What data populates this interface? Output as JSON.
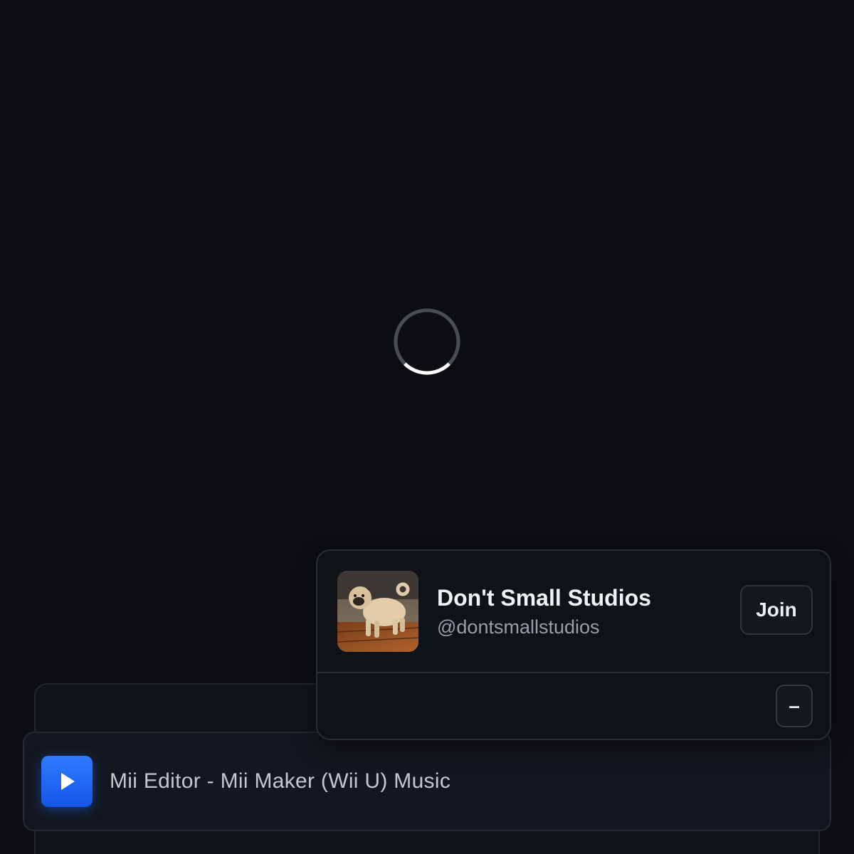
{
  "loading": {
    "indicator": "loading-spinner-icon"
  },
  "studio": {
    "name": "Don't Small Studios",
    "handle": "@dontsmallstudios",
    "join_label": "Join",
    "minimize_label": "–",
    "avatar_description_icon": "pug-avatar-image"
  },
  "player": {
    "play_icon": "play-icon",
    "track_title": "Mii Editor - Mii Maker (Wii U) Music"
  },
  "colors": {
    "background": "#0c0e13",
    "accent": "#1f66f5",
    "card": "#0f1217",
    "border": "#2a2e35"
  }
}
